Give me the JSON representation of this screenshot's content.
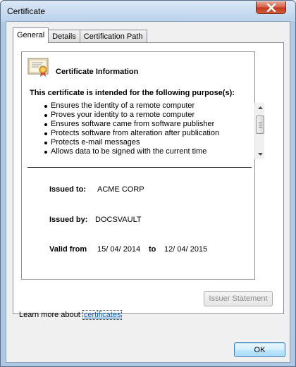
{
  "window": {
    "title": "Certificate"
  },
  "tabs": [
    {
      "label": "General"
    },
    {
      "label": "Details"
    },
    {
      "label": "Certification Path"
    }
  ],
  "certificate": {
    "info_title": "Certificate Information",
    "purpose_heading": "This certificate is intended for the following purpose(s):",
    "purposes": [
      "Ensures the identity of a remote computer",
      "Proves your identity to a remote computer",
      "Ensures software came from software publisher",
      "Protects software from alteration after publication",
      "Protects e-mail messages",
      "Allows data to be signed with the current time"
    ],
    "issued_to_label": "Issued to:",
    "issued_to_value": "ACME CORP",
    "issued_by_label": "Issued by:",
    "issued_by_value": "DOCSVAULT",
    "valid_from_label": "Valid from",
    "valid_from_value": "15/ 04/ 2014",
    "valid_to_label": "to",
    "valid_to_value": "12/ 04/ 2015"
  },
  "buttons": {
    "issuer_statement": "Issuer Statement",
    "ok": "OK"
  },
  "learn_more": {
    "prefix": "Learn more about ",
    "link": "certificates"
  },
  "colors": {
    "accent": "#3c7fb1",
    "link": "#0066cc",
    "close_button": "#c23a1e"
  }
}
